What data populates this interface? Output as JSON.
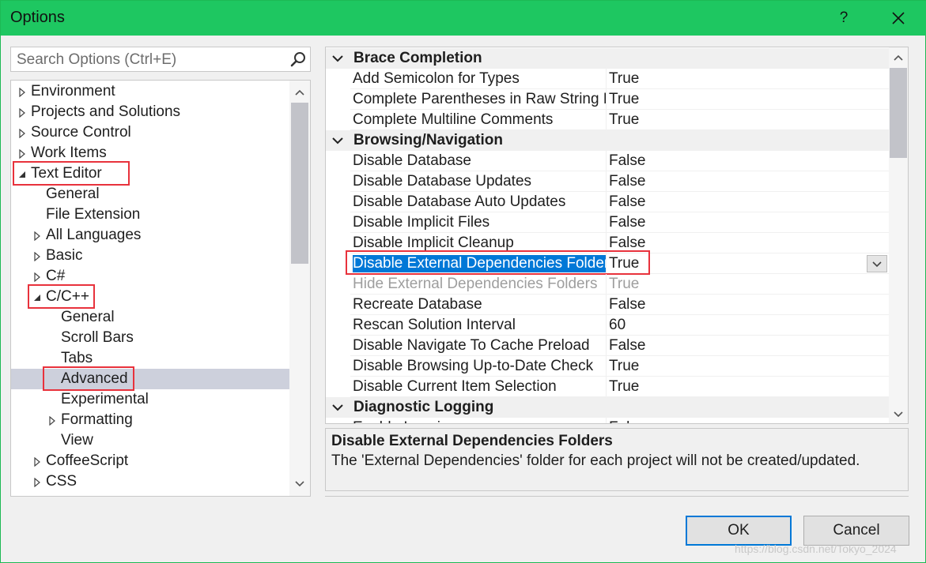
{
  "window": {
    "title": "Options",
    "help_label": "?"
  },
  "search": {
    "placeholder": "Search Options (Ctrl+E)"
  },
  "tree": {
    "items": [
      {
        "label": "Environment",
        "glyph": "collapsed",
        "indent": 0
      },
      {
        "label": "Projects and Solutions",
        "glyph": "collapsed",
        "indent": 0
      },
      {
        "label": "Source Control",
        "glyph": "collapsed",
        "indent": 0
      },
      {
        "label": "Work Items",
        "glyph": "collapsed",
        "indent": 0
      },
      {
        "label": "Text Editor",
        "glyph": "expanded",
        "indent": 0,
        "highlight": true
      },
      {
        "label": "General",
        "glyph": "none",
        "indent": 1
      },
      {
        "label": "File Extension",
        "glyph": "none",
        "indent": 1
      },
      {
        "label": "All Languages",
        "glyph": "collapsed",
        "indent": 1
      },
      {
        "label": "Basic",
        "glyph": "collapsed",
        "indent": 1
      },
      {
        "label": "C#",
        "glyph": "collapsed",
        "indent": 1
      },
      {
        "label": "C/C++",
        "glyph": "expanded",
        "indent": 1,
        "highlight": true
      },
      {
        "label": "General",
        "glyph": "none",
        "indent": 2
      },
      {
        "label": "Scroll Bars",
        "glyph": "none",
        "indent": 2
      },
      {
        "label": "Tabs",
        "glyph": "none",
        "indent": 2
      },
      {
        "label": "Advanced",
        "glyph": "none",
        "indent": 2,
        "selected": true,
        "highlight": true
      },
      {
        "label": "Experimental",
        "glyph": "none",
        "indent": 2
      },
      {
        "label": "Formatting",
        "glyph": "collapsed",
        "indent": 2
      },
      {
        "label": "View",
        "glyph": "none",
        "indent": 2
      },
      {
        "label": "CoffeeScript",
        "glyph": "collapsed",
        "indent": 1
      },
      {
        "label": "CSS",
        "glyph": "collapsed",
        "indent": 1
      }
    ]
  },
  "grid": {
    "rows": [
      {
        "kind": "category",
        "label": "Brace Completion"
      },
      {
        "kind": "property",
        "name": "Add Semicolon for Types",
        "value": "True"
      },
      {
        "kind": "property",
        "name": "Complete Parentheses in Raw String Literals",
        "value": "True"
      },
      {
        "kind": "property",
        "name": "Complete Multiline Comments",
        "value": "True"
      },
      {
        "kind": "category",
        "label": "Browsing/Navigation"
      },
      {
        "kind": "property",
        "name": "Disable Database",
        "value": "False"
      },
      {
        "kind": "property",
        "name": "Disable Database Updates",
        "value": "False"
      },
      {
        "kind": "property",
        "name": "Disable Database Auto Updates",
        "value": "False"
      },
      {
        "kind": "property",
        "name": "Disable Implicit Files",
        "value": "False"
      },
      {
        "kind": "property",
        "name": "Disable Implicit Cleanup",
        "value": "False"
      },
      {
        "kind": "property",
        "name": "Disable External Dependencies Folders",
        "value": "True",
        "selected": true,
        "highlight": true
      },
      {
        "kind": "property",
        "name": "Hide External Dependencies Folders",
        "value": "True",
        "disabled": true
      },
      {
        "kind": "property",
        "name": "Recreate Database",
        "value": "False"
      },
      {
        "kind": "property",
        "name": "Rescan Solution Interval",
        "value": "60"
      },
      {
        "kind": "property",
        "name": "Disable Navigate To Cache Preload",
        "value": "False"
      },
      {
        "kind": "property",
        "name": "Disable Browsing Up-to-Date Check",
        "value": "True"
      },
      {
        "kind": "property",
        "name": "Disable Current Item Selection",
        "value": "True"
      },
      {
        "kind": "category",
        "label": "Diagnostic Logging"
      },
      {
        "kind": "property",
        "name": "Enable Logging",
        "value": "False"
      }
    ]
  },
  "description": {
    "title": "Disable External Dependencies Folders",
    "body": "The 'External Dependencies' folder for each project will not be created/updated."
  },
  "buttons": {
    "ok": "OK",
    "cancel": "Cancel"
  },
  "watermark": "https://blog.csdn.net/Tokyo_2024",
  "colors": {
    "titlebar": "#1ec761",
    "selection": "#0078d7",
    "tree_selection": "#cdd0dc",
    "highlight_box": "#e8323c"
  }
}
